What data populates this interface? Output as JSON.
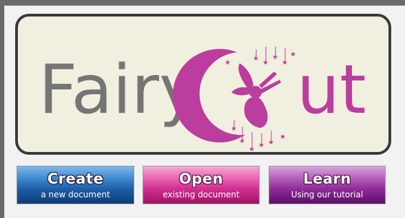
{
  "logo": {
    "word_fairy": "Fairy",
    "word_cut": "Cut",
    "color_gray": "#757575",
    "color_magenta": "#bb3d9d",
    "emblem": "fairy-on-crescent-moon-icon"
  },
  "buttons": [
    {
      "id": "create",
      "title": "Create",
      "subtitle": "a new document",
      "color": "#1e5fa8"
    },
    {
      "id": "open",
      "title": "Open",
      "subtitle": "existing document",
      "color": "#d12f90"
    },
    {
      "id": "learn",
      "title": "Learn",
      "subtitle": "Using our tutorial",
      "color": "#8f2d98"
    }
  ]
}
